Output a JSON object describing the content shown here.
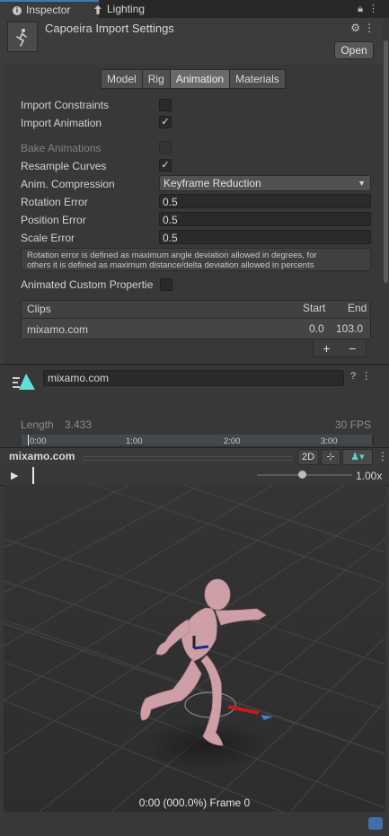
{
  "tabs": [
    {
      "label": "Inspector",
      "icon": "info-icon",
      "active": true
    },
    {
      "label": "Lighting",
      "icon": "lighting-icon",
      "active": false
    }
  ],
  "header": {
    "title": "Capoeira Import Settings",
    "open_label": "Open",
    "icons": [
      "sliders-icon",
      "kebab-icon"
    ]
  },
  "subtabs": [
    "Model",
    "Rig",
    "Animation",
    "Materials"
  ],
  "active_subtab": "Animation",
  "settings": {
    "import_constraints": {
      "label": "Import Constraints",
      "checked": false
    },
    "import_animation": {
      "label": "Import Animation",
      "checked": true
    },
    "bake_animations": {
      "label": "Bake Animations",
      "checked": false,
      "disabled": true
    },
    "resample_curves": {
      "label": "Resample Curves",
      "checked": true
    },
    "anim_compression": {
      "label": "Anim. Compression",
      "value": "Keyframe Reduction"
    },
    "rotation_error": {
      "label": "Rotation Error",
      "value": "0.5"
    },
    "position_error": {
      "label": "Position Error",
      "value": "0.5"
    },
    "scale_error": {
      "label": "Scale Error",
      "value": "0.5"
    },
    "help_line1": "Rotation error is defined as maximum angle deviation allowed in degrees, for",
    "help_line2": "others it is defined as maximum distance/delta deviation allowed in percents",
    "animated_custom": {
      "label": "Animated Custom Propertie",
      "checked": false
    }
  },
  "clips": {
    "header": {
      "name": "Clips",
      "start": "Start",
      "end": "End"
    },
    "rows": [
      {
        "name": "mixamo.com",
        "start": "0.0",
        "end": "103.0"
      }
    ],
    "add": "+",
    "remove": "−"
  },
  "clip_props": {
    "name_value": "mixamo.com",
    "length_label": "Length",
    "length_value": "3.433",
    "fps": "30 FPS",
    "ticks": [
      "0:00",
      "1:00",
      "2:00",
      "3:00"
    ]
  },
  "preview": {
    "title": "mixamo.com",
    "mode_2d": "2D",
    "speed": "1.00x",
    "frame_label": "0:00 (000.0%) Frame 0"
  }
}
